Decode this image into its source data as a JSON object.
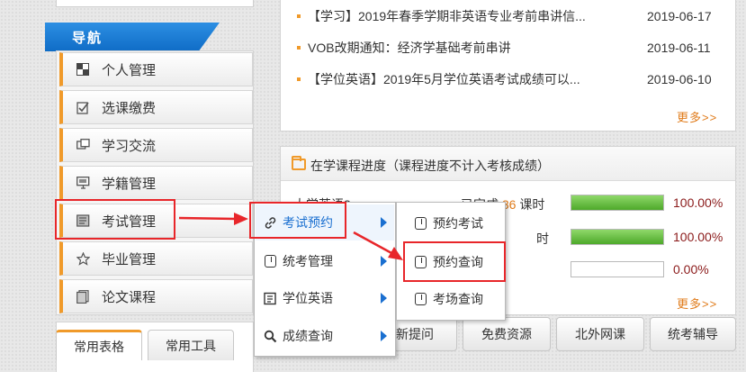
{
  "sidebar": {
    "header": "导航",
    "items": [
      {
        "label": "个人管理",
        "icon": "user-card-icon"
      },
      {
        "label": "选课缴费",
        "icon": "checklist-icon"
      },
      {
        "label": "学习交流",
        "icon": "chat-icon"
      },
      {
        "label": "学籍管理",
        "icon": "monitor-icon"
      },
      {
        "label": "考试管理",
        "icon": "exam-icon"
      },
      {
        "label": "毕业管理",
        "icon": "star-icon"
      },
      {
        "label": "论文课程",
        "icon": "document-icon"
      }
    ]
  },
  "tabs": {
    "active": "常用表格",
    "inactive": "常用工具"
  },
  "news": {
    "items": [
      {
        "title": "【学习】2019年春季学期非英语专业考前串讲信...",
        "date": "2019-06-17"
      },
      {
        "title": "VOB改期通知：经济学基础考前串讲",
        "date": "2019-06-11"
      },
      {
        "title": "【学位英语】2019年5月学位英语考试成绩可以...",
        "date": "2019-06-10"
      }
    ],
    "more": "更多>>"
  },
  "progress": {
    "title": "在学课程进度（课程进度不计入考核成绩）",
    "rows": [
      {
        "course": "大学英语3",
        "done_prefix": "已完成",
        "done_num": "36",
        "done_unit": "课时",
        "value": 1.0,
        "pct": "100.00%"
      },
      {
        "course": "",
        "done_prefix": "",
        "done_num": "",
        "done_unit": "时",
        "value": 1.0,
        "pct": "100.00%"
      },
      {
        "course": "",
        "done_prefix": "",
        "done_num": "",
        "done_unit": "",
        "value": 0.0,
        "pct": "0.00%"
      }
    ],
    "more": "更多>>"
  },
  "buttons": [
    "最新提问",
    "免费资源",
    "北外网课",
    "统考辅导"
  ],
  "menu1": [
    {
      "label": "考试预约",
      "icon": "link-icon"
    },
    {
      "label": "统考管理",
      "icon": "clipboard-icon"
    },
    {
      "label": "学位英语",
      "icon": "list-icon"
    },
    {
      "label": "成绩查询",
      "icon": "magnifier-icon"
    }
  ],
  "menu2": [
    {
      "label": "预约考试",
      "icon": "clipboard-icon"
    },
    {
      "label": "预约查询",
      "icon": "clipboard-icon"
    },
    {
      "label": "考场查询",
      "icon": "clipboard-icon"
    }
  ],
  "colors": {
    "accent": "#f09a2a",
    "nav_blue": "#1a6fd0",
    "annotation_red": "#e8262a",
    "progress_green": "#5bb536"
  }
}
